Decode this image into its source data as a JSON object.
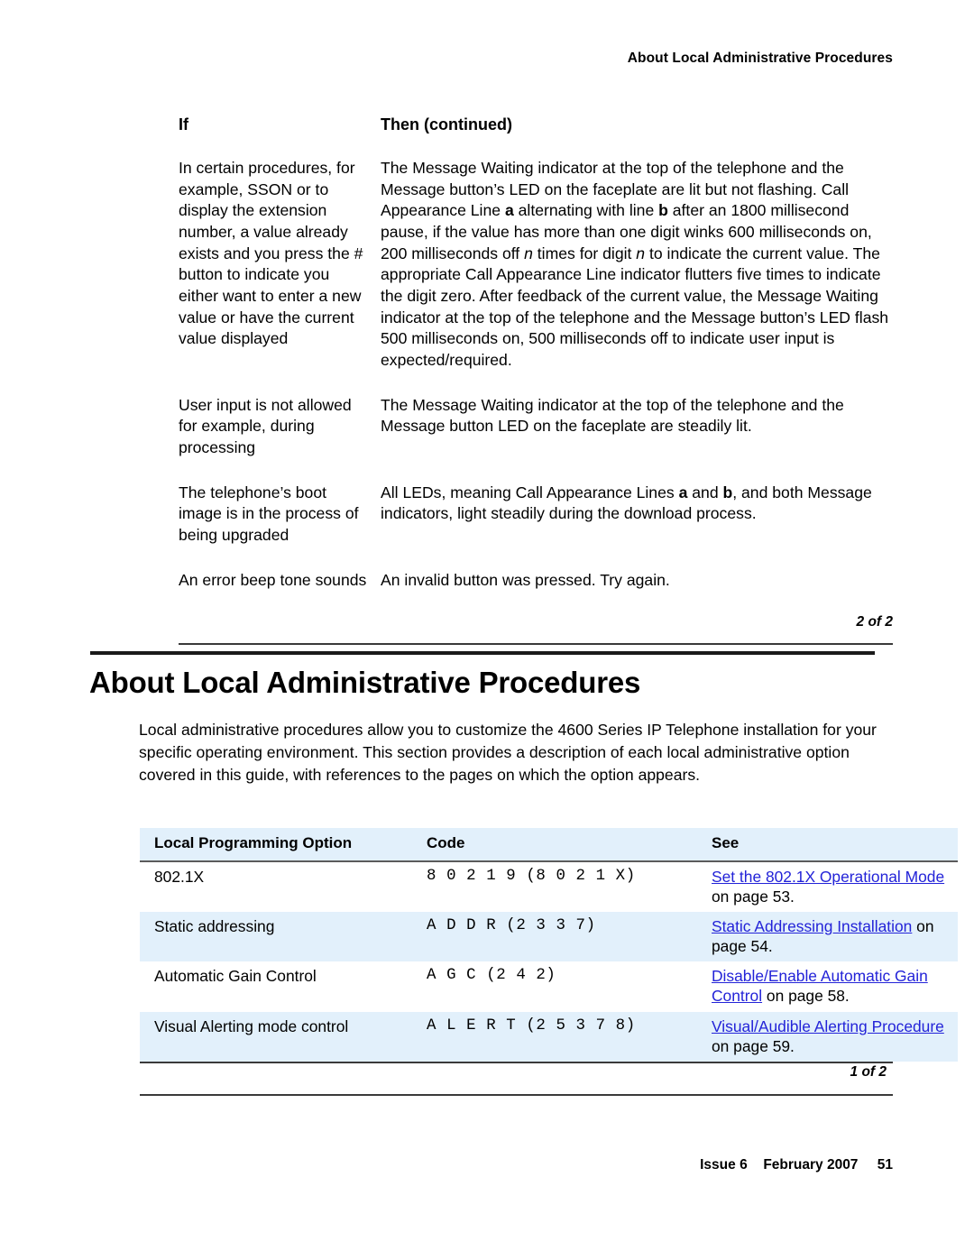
{
  "running_header": "About Local Administrative Procedures",
  "continued_table": {
    "headers": {
      "if": "If",
      "then": "Then  (continued)"
    },
    "rows": [
      {
        "if": "In certain procedures, for example, SSON or to display the extension number, a value already exists and you press the # button to indicate you either want to enter a new value or have the current value displayed",
        "then": "The Message Waiting indicator at the top of the telephone and the Message button’s LED on the faceplate are lit but not flashing. Call Appearance Line a alternating with line b after an 1800 millisecond pause, if the value has more than one digit winks 600 milliseconds on, 200 milliseconds off n times for digit n to indicate the current value. The appropriate Call Appearance Line indicator flutters five times to indicate the digit zero. After feedback of the current value, the Message Waiting indicator at the top of the telephone and the Message button’s LED flash 500 milliseconds on, 500 milliseconds off to indicate user input is expected/required."
      },
      {
        "if": "User input is not allowed for example, during processing",
        "then": "The Message Waiting indicator at the top of the telephone and the Message button LED on the faceplate are steadily lit."
      },
      {
        "if": "The telephone’s boot image is in the process of being upgraded",
        "then": "All LEDs, meaning Call Appearance Lines a and b, and both Message indicators, light steadily during the download process."
      },
      {
        "if": "An error beep tone sounds",
        "then": "An invalid button was pressed. Try again."
      }
    ],
    "sheet_mark": "2 of 2"
  },
  "chapter": {
    "title": "About Local Administrative Procedures",
    "intro": "Local administrative procedures allow you to customize the 4600 Series IP Telephone installation for your specific operating environment. This section provides a description of each local administrative option covered in this guide, with references to the pages on which the option appears."
  },
  "options_table": {
    "headers": [
      "Local Programming Option",
      "Code",
      "See"
    ],
    "rows": [
      {
        "option": "802.1X",
        "code": "8 0 2 1 9 (8 0 2 1 X)",
        "see_link": "Set the 802.1X Operational Mode",
        "see_tail": " on page 53.",
        "shaded": false
      },
      {
        "option": "Static addressing",
        "code": "A D D R (2 3 3 7)",
        "see_link": "Static Addressing Installation",
        "see_tail": " on page 54.",
        "shaded": true
      },
      {
        "option": "Automatic Gain Control",
        "code": "A G C (2 4 2)",
        "see_link": "Disable/Enable Automatic Gain Control",
        "see_tail": " on page 58.",
        "shaded": false
      },
      {
        "option": "Visual Alerting mode control",
        "code": "A L E R T (2 5 3 7 8)",
        "see_link": "Visual/Audible Alerting Procedure",
        "see_tail": " on page 59.",
        "shaded": true
      }
    ],
    "sheet_mark": "1 of 2"
  },
  "footer": {
    "issue": "Issue 6",
    "date": "February 2007",
    "page_number": "51"
  },
  "colors": {
    "table_shade": "#e2f0fb",
    "link": "#2323d8",
    "rule": "#3a3a3a"
  }
}
